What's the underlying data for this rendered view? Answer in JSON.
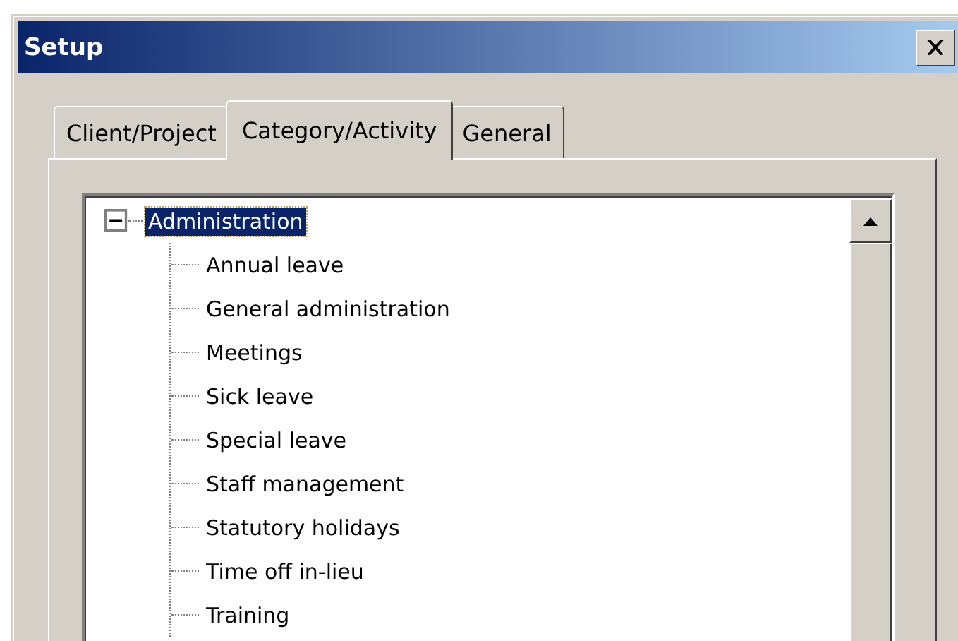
{
  "window": {
    "title": "Setup"
  },
  "tabs": [
    {
      "label": "Client/Project",
      "selected": false
    },
    {
      "label": "Category/Activity",
      "selected": true
    },
    {
      "label": "General",
      "selected": false
    }
  ],
  "tree": [
    {
      "label": "Administration",
      "expanded": true,
      "selected": true,
      "children": [
        {
          "label": "Annual leave",
          "selected": false
        },
        {
          "label": "General administration",
          "selected": false
        },
        {
          "label": "Meetings",
          "selected": false
        },
        {
          "label": "Sick leave",
          "selected": false
        },
        {
          "label": "Special leave",
          "selected": false
        },
        {
          "label": "Staff management",
          "selected": false
        },
        {
          "label": "Statutory holidays",
          "selected": false
        },
        {
          "label": "Time off in-lieu",
          "selected": false
        },
        {
          "label": "Training",
          "selected": false
        }
      ]
    }
  ]
}
